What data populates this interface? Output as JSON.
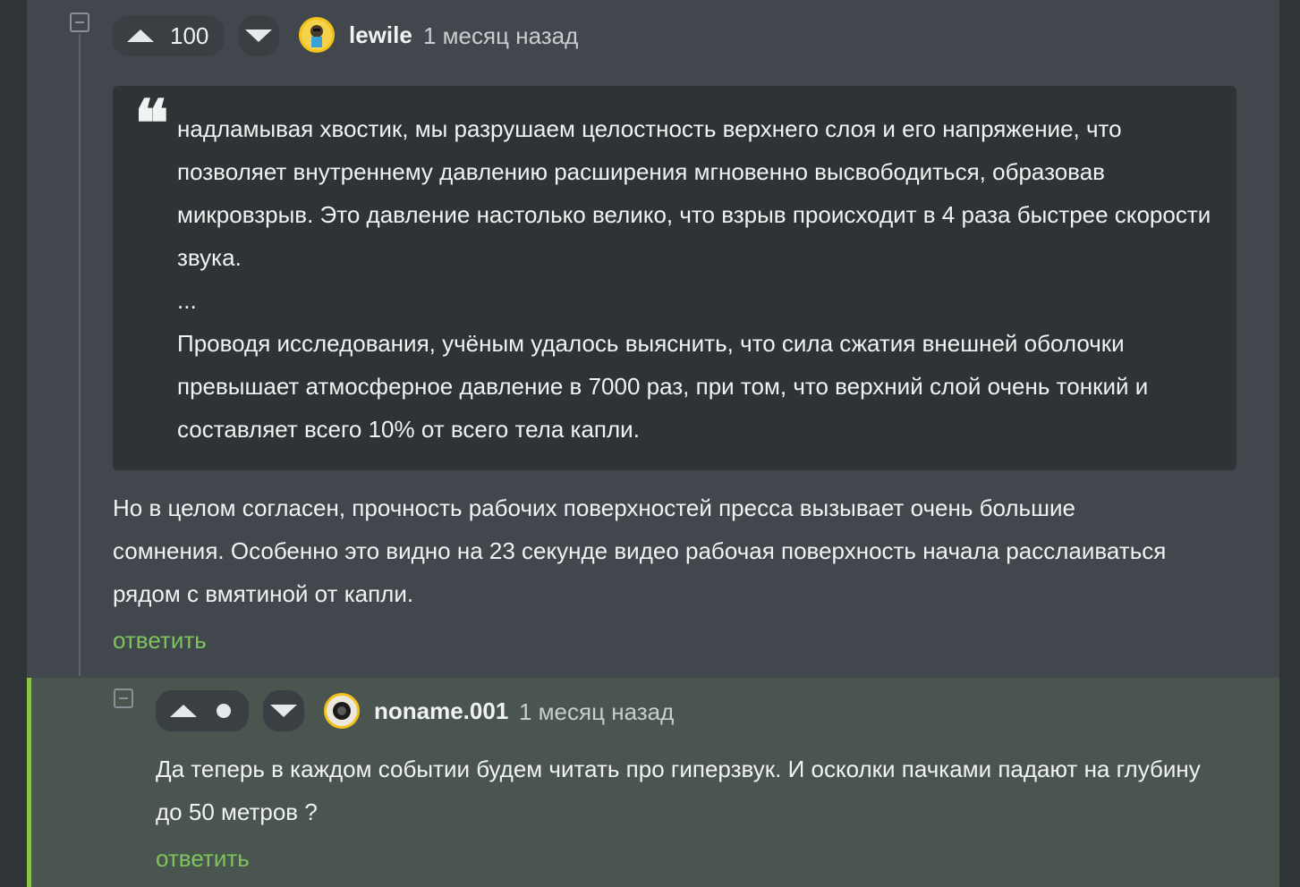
{
  "comments": [
    {
      "score": "100",
      "username": "lewile",
      "timestamp": "1 месяц назад",
      "quote_mark": "❝",
      "quote_paragraphs": [
        "надламывая хвостик, мы разрушаем целостность верхнего слоя и его напряжение, что позволяет внутреннему давлению расширения мгновенно высвободиться, образовав микровзрыв. Это давление настолько велико, что взрыв происходит в 4 раза быстрее скорости звука.",
        "...",
        "Проводя исследования, учёным удалось выяснить, что сила сжатия внешней оболочки превышает атмосферное давление в 7000 раз, при том, что верхний слой очень тонкий и составляет всего 10% от всего тела капли."
      ],
      "text": "Но в целом согласен, прочность рабочих поверхностей пресса вызывает очень большие сомнения. Особенно это видно на 23 секунде видео рабочая поверхность начала расслаиваться рядом с вмятиной от капли.",
      "reply_label": "ответить"
    },
    {
      "score": "",
      "username": "noname.001",
      "timestamp": "1 месяц назад",
      "text": "Да теперь в каждом событии будем читать про гиперзвук. И осколки пачками падают на глубину до 50 метров ?",
      "reply_label": "ответить"
    }
  ],
  "colors": {
    "accent_green": "#7ec45d",
    "thread_border": "#8bc34a",
    "background": "#41474c",
    "nested_background": "#4a5550"
  },
  "icons": {
    "collapse": "minus-square-icon",
    "vote_up": "triangle-up-icon",
    "vote_down": "triangle-down-icon",
    "neutral_score": "dot-icon"
  }
}
